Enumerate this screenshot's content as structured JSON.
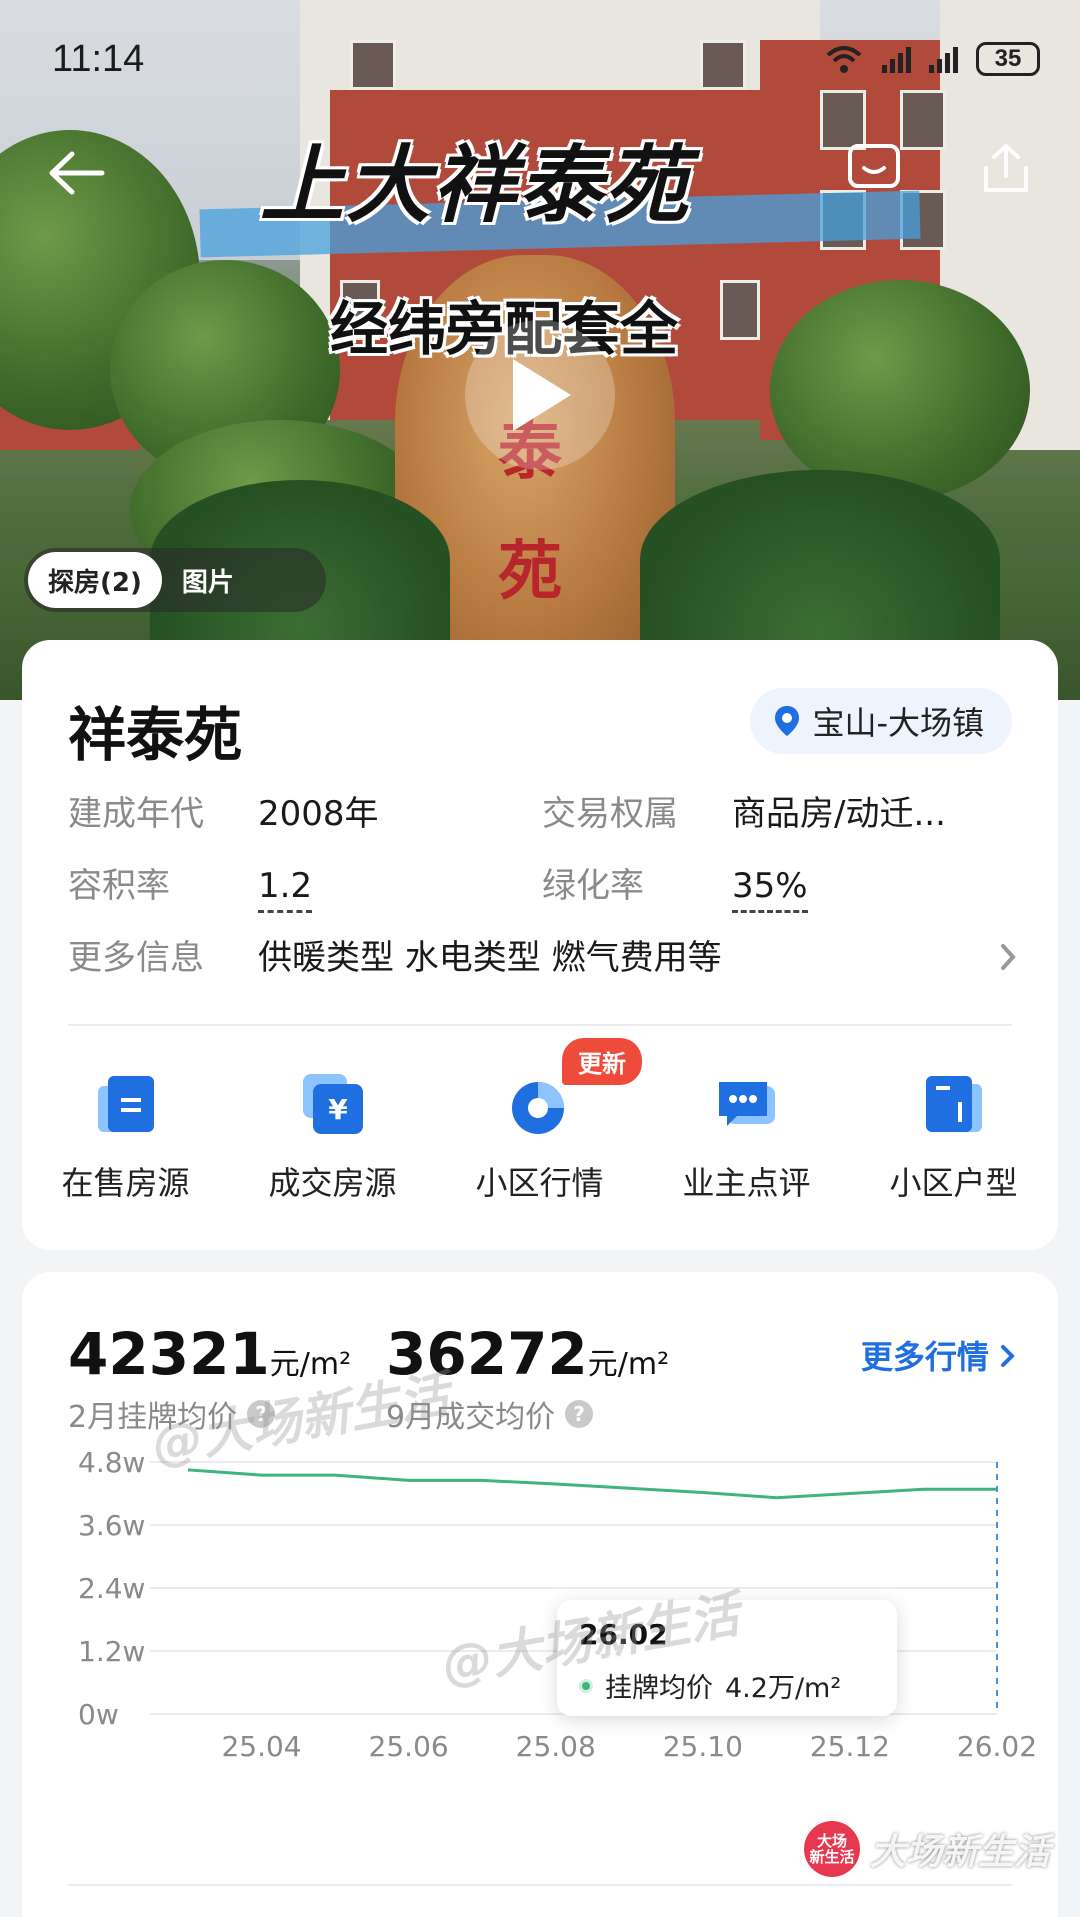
{
  "status_bar": {
    "time": "11:14",
    "battery": "35"
  },
  "hero": {
    "video_title": "上大祥泰苑",
    "video_subtitle": "经纬旁配套全",
    "rock_text": [
      "泰",
      "苑"
    ],
    "media_tabs": [
      {
        "label": "探房(2)",
        "active": true
      },
      {
        "label": "图片",
        "active": false
      }
    ]
  },
  "community": {
    "name": "祥泰苑",
    "location": "宝山-大场镇",
    "fields": [
      {
        "label": "建成年代",
        "value": "2008年"
      },
      {
        "label": "交易权属",
        "value": "商品房/动迁..."
      },
      {
        "label": "容积率",
        "value": "1.2"
      },
      {
        "label": "绿化率",
        "value": "35%"
      },
      {
        "label": "更多信息",
        "value": "供暖类型 水电类型 燃气费用等"
      }
    ],
    "quick_links": [
      {
        "label": "在售房源",
        "icon": "listing-icon"
      },
      {
        "label": "成交房源",
        "icon": "yuan-icon"
      },
      {
        "label": "小区行情",
        "icon": "pie-chart-icon",
        "badge": "更新"
      },
      {
        "label": "业主点评",
        "icon": "chat-icon"
      },
      {
        "label": "小区户型",
        "icon": "floorplan-icon"
      }
    ]
  },
  "price": {
    "listing_avg": "42321",
    "listing_unit": "元/m²",
    "listing_label": "2月挂牌均价",
    "deal_avg": "36272",
    "deal_unit": "元/m²",
    "deal_label": "9月成交均价",
    "more_link": "更多行情",
    "tooltip": {
      "date": "26.02",
      "series": "挂牌均价",
      "value": "4.2万/m²"
    }
  },
  "chart_data": {
    "type": "line",
    "x": [
      "25.03",
      "25.04",
      "25.05",
      "25.06",
      "25.07",
      "25.08",
      "25.09",
      "25.10",
      "25.11",
      "25.12",
      "26.01",
      "26.02"
    ],
    "x_tick_labels": [
      "25.04",
      "25.06",
      "25.08",
      "25.10",
      "25.12",
      "26.02"
    ],
    "series": [
      {
        "name": "挂牌均价",
        "values": [
          4.65,
          4.55,
          4.55,
          4.45,
          4.45,
          4.38,
          4.3,
          4.22,
          4.12,
          4.2,
          4.28,
          4.28
        ],
        "color": "#3fb47d"
      }
    ],
    "y_tick_labels": [
      "4.8w",
      "3.6w",
      "2.4w",
      "1.2w",
      "0w"
    ],
    "ylim": [
      0,
      4.8
    ],
    "grid": true
  },
  "watermarks": [
    "@大场新生活",
    "@大场新生活"
  ],
  "brand": {
    "logo_text": [
      "大场",
      "新生活"
    ],
    "name": "大场新生活"
  },
  "colors": {
    "accent": "#1f6fe0",
    "line": "#3fb47d",
    "badge": "#ee4b3a"
  }
}
